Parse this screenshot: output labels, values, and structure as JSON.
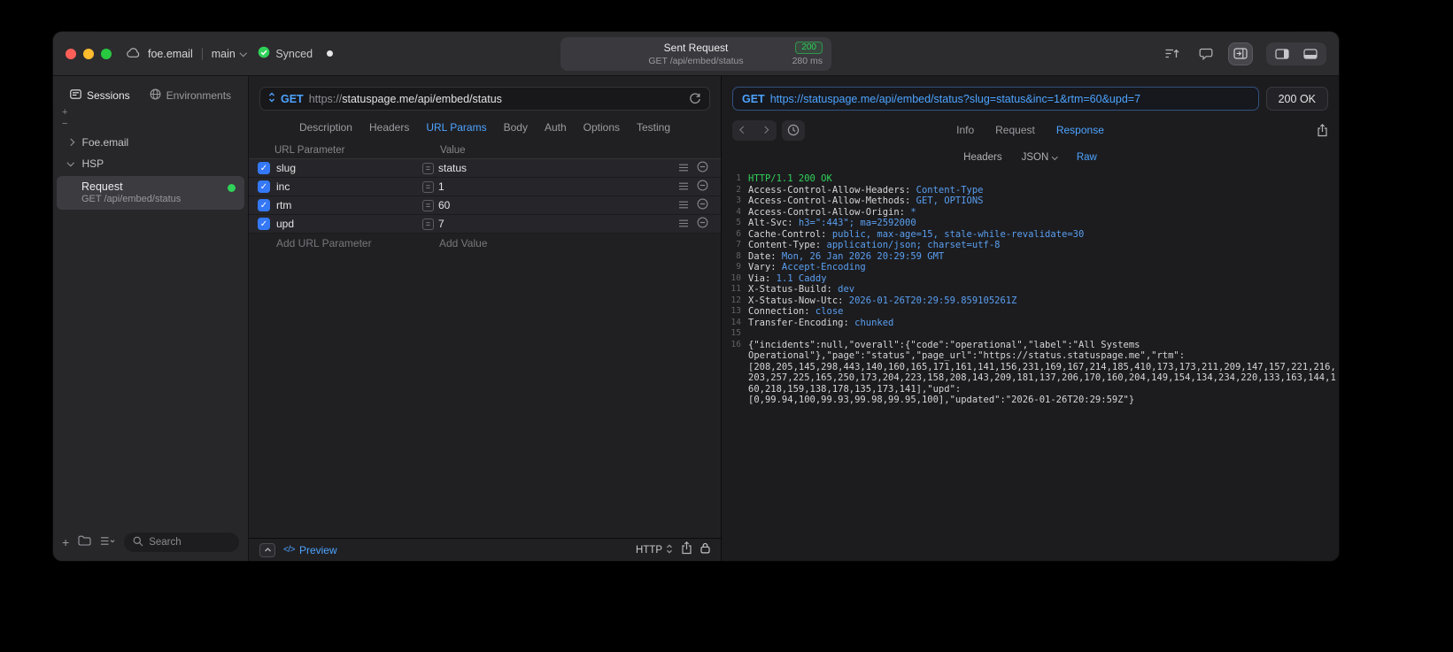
{
  "colors": {
    "accent_blue": "#4da3ff",
    "success_green": "#30d158"
  },
  "titlebar": {
    "project": "foe.email",
    "branch": "main",
    "sync": "Synced",
    "request_summary": {
      "title": "Sent Request",
      "status": "200",
      "subtitle": "GET /api/embed/status",
      "duration": "280 ms"
    }
  },
  "sidebar": {
    "tabs": [
      {
        "label": "Sessions",
        "active": true
      },
      {
        "label": "Environments",
        "active": false
      }
    ],
    "tree": [
      {
        "label": "Foe.email",
        "expanded": false
      },
      {
        "label": "HSP",
        "expanded": true
      }
    ],
    "request_item": {
      "title": "Request",
      "subtitle": "GET /api/embed/status"
    },
    "search_placeholder": "Search"
  },
  "request": {
    "method": "GET",
    "url_scheme": "https://",
    "url_host_path": "statuspage.me/api/embed/status",
    "tabs": [
      {
        "label": "Description"
      },
      {
        "label": "Headers"
      },
      {
        "label": "URL Params",
        "active": true
      },
      {
        "label": "Body"
      },
      {
        "label": "Auth"
      },
      {
        "label": "Options"
      },
      {
        "label": "Testing"
      }
    ],
    "params": {
      "col_key": "URL Parameter",
      "col_value": "Value",
      "rows": [
        {
          "key": "slug",
          "value": "status",
          "checked": true
        },
        {
          "key": "inc",
          "value": "1",
          "checked": true
        },
        {
          "key": "rtm",
          "value": "60",
          "checked": true
        },
        {
          "key": "upd",
          "value": "7",
          "checked": true
        }
      ],
      "add_key": "Add URL Parameter",
      "add_value": "Add Value"
    },
    "footer": {
      "preview": "Preview",
      "protocol": "HTTP"
    }
  },
  "response": {
    "method": "GET",
    "url": "https://statuspage.me/api/embed/status?slug=status&inc=1&rtm=60&upd=7",
    "status": "200 OK",
    "tabs": [
      {
        "label": "Info"
      },
      {
        "label": "Request"
      },
      {
        "label": "Response",
        "active": true
      }
    ],
    "subtabs": [
      {
        "label": "Headers"
      },
      {
        "label": "JSON",
        "dropdown": true
      },
      {
        "label": "Raw",
        "active": true
      }
    ],
    "lines": [
      {
        "n": "1",
        "text": "HTTP/1.1 200 OK",
        "type": "green"
      },
      {
        "n": "2",
        "key": "Access-Control-Allow-Headers:",
        "value": " Content-Type"
      },
      {
        "n": "3",
        "key": "Access-Control-Allow-Methods:",
        "value": " GET, OPTIONS"
      },
      {
        "n": "4",
        "key": "Access-Control-Allow-Origin:",
        "value": " *"
      },
      {
        "n": "5",
        "key": "Alt-Svc:",
        "value": " h3=\":443\"; ma=2592000"
      },
      {
        "n": "6",
        "key": "Cache-Control:",
        "value": " public, max-age=15, stale-while-revalidate=30"
      },
      {
        "n": "7",
        "key": "Content-Type:",
        "value": " application/json; charset=utf-8"
      },
      {
        "n": "8",
        "key": "Date:",
        "value": " Mon, 26 Jan 2026 20:29:59 GMT"
      },
      {
        "n": "9",
        "key": "Vary:",
        "value": " Accept-Encoding"
      },
      {
        "n": "10",
        "key": "Via:",
        "value": " 1.1 Caddy"
      },
      {
        "n": "11",
        "key": "X-Status-Build:",
        "value": " dev"
      },
      {
        "n": "12",
        "key": "X-Status-Now-Utc:",
        "value": " 2026-01-26T20:29:59.859105261Z"
      },
      {
        "n": "13",
        "key": "Connection:",
        "value": " close"
      },
      {
        "n": "14",
        "key": "Transfer-Encoding:",
        "value": " chunked"
      },
      {
        "n": "15",
        "text": ""
      },
      {
        "n": "16",
        "text": "{\"incidents\":null,\"overall\":{\"code\":\"operational\",\"label\":\"All Systems",
        "type": "body"
      },
      {
        "n": "",
        "text": "Operational\"},\"page\":\"status\",\"page_url\":\"https://status.statuspage.me\",\"rtm\":",
        "type": "body"
      },
      {
        "n": "",
        "text": "[208,205,145,298,443,140,160,165,171,161,141,156,231,169,167,214,185,410,173,173,211,209,147,157,221,216,",
        "type": "body"
      },
      {
        "n": "",
        "text": "203,257,225,165,250,173,204,223,158,208,143,209,181,137,206,170,160,204,149,154,134,234,220,133,163,144,1",
        "type": "body"
      },
      {
        "n": "",
        "text": "60,218,159,138,178,135,173,141],\"upd\":",
        "type": "body"
      },
      {
        "n": "",
        "text": "[0,99.94,100,99.93,99.98,99.95,100],\"updated\":\"2026-01-26T20:29:59Z\"}",
        "type": "body"
      }
    ]
  }
}
